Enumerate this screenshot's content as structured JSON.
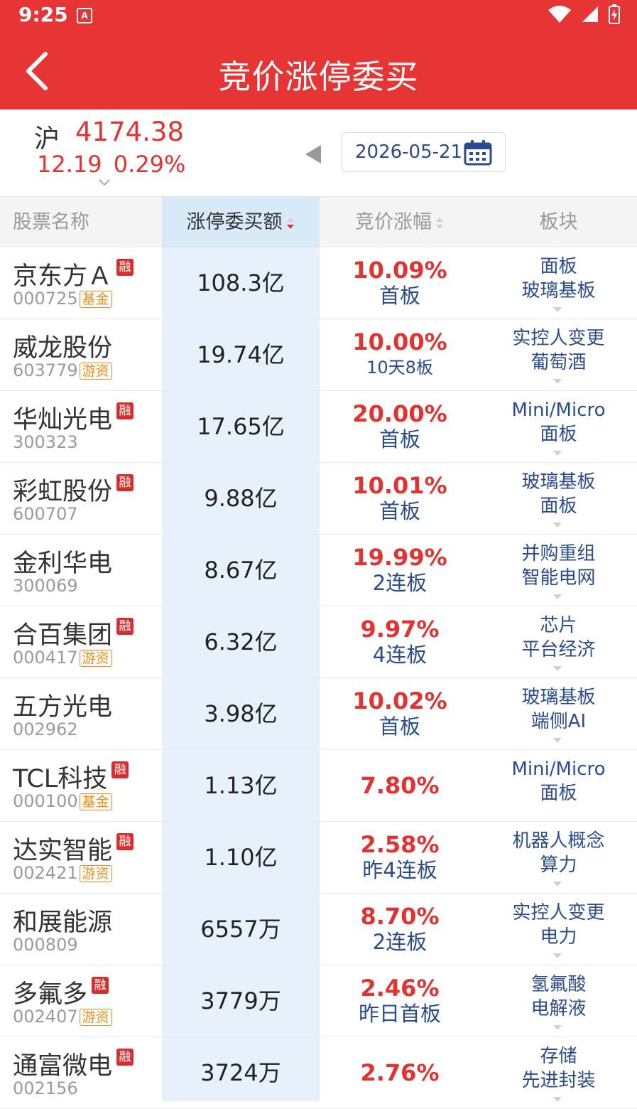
{
  "status": {
    "time": "9:25",
    "badge": "A"
  },
  "header": {
    "title": "竞价涨停委买"
  },
  "index": {
    "name": "沪",
    "value": "4174.38",
    "change": "12.19",
    "change_pct": "0.29%"
  },
  "date": "2026-05-21",
  "columns": {
    "name": "股票名称",
    "amount": "涨停委买额",
    "pct": "竞价涨幅",
    "sector": "板块"
  },
  "rong_label": "融",
  "colors": {
    "header": "#e73434",
    "up": "#e33232",
    "link": "#2b4c8c",
    "tag": "#f08c1a",
    "highlight": "#e6f1fb"
  },
  "stocks": [
    {
      "name": "京东方Ａ",
      "code": "000725",
      "rong": true,
      "tag": "基金",
      "amount": "108.3亿",
      "pct": "10.09%",
      "board": "首板",
      "sectors": [
        "面板",
        "玻璃基板"
      ],
      "arrow": true
    },
    {
      "name": "威龙股份",
      "code": "603779",
      "rong": false,
      "tag": "游资",
      "amount": "19.74亿",
      "pct": "10.00%",
      "board": "10天8板",
      "sectors": [
        "实控人变更",
        "葡萄酒"
      ],
      "arrow": true
    },
    {
      "name": "华灿光电",
      "code": "300323",
      "rong": true,
      "tag": "",
      "amount": "17.65亿",
      "pct": "20.00%",
      "board": "首板",
      "sectors": [
        "Mini/Micro",
        "面板"
      ],
      "arrow": true
    },
    {
      "name": "彩虹股份",
      "code": "600707",
      "rong": true,
      "tag": "",
      "amount": "9.88亿",
      "pct": "10.01%",
      "board": "首板",
      "sectors": [
        "玻璃基板",
        "面板"
      ],
      "arrow": true
    },
    {
      "name": "金利华电",
      "code": "300069",
      "rong": false,
      "tag": "",
      "amount": "8.67亿",
      "pct": "19.99%",
      "board": "2连板",
      "sectors": [
        "并购重组",
        "智能电网"
      ],
      "arrow": true
    },
    {
      "name": "合百集团",
      "code": "000417",
      "rong": true,
      "tag": "游资",
      "amount": "6.32亿",
      "pct": "9.97%",
      "board": "4连板",
      "sectors": [
        "芯片",
        "平台经济"
      ],
      "arrow": true
    },
    {
      "name": "五方光电",
      "code": "002962",
      "rong": false,
      "tag": "",
      "amount": "3.98亿",
      "pct": "10.02%",
      "board": "首板",
      "sectors": [
        "玻璃基板",
        "端侧AI"
      ],
      "arrow": true
    },
    {
      "name": "TCL科技",
      "code": "000100",
      "rong": true,
      "tag": "基金",
      "amount": "1.13亿",
      "pct": "7.80%",
      "board": "",
      "sectors": [
        "Mini/Micro",
        "面板"
      ],
      "arrow": false
    },
    {
      "name": "达实智能",
      "code": "002421",
      "rong": true,
      "tag": "游资",
      "amount": "1.10亿",
      "pct": "2.58%",
      "board": "昨4连板",
      "sectors": [
        "机器人概念",
        "算力"
      ],
      "arrow": true
    },
    {
      "name": "和展能源",
      "code": "000809",
      "rong": false,
      "tag": "",
      "amount": "6557万",
      "pct": "8.70%",
      "board": "2连板",
      "sectors": [
        "实控人变更",
        "电力"
      ],
      "arrow": true
    },
    {
      "name": "多氟多",
      "code": "002407",
      "rong": true,
      "tag": "游资",
      "amount": "3779万",
      "pct": "2.46%",
      "board": "昨日首板",
      "sectors": [
        "氢氟酸",
        "电解液"
      ],
      "arrow": true
    },
    {
      "name": "通富微电",
      "code": "002156",
      "rong": true,
      "tag": "",
      "amount": "3724万",
      "pct": "2.76%",
      "board": "",
      "sectors": [
        "存储",
        "先进封装"
      ],
      "arrow": true
    }
  ]
}
